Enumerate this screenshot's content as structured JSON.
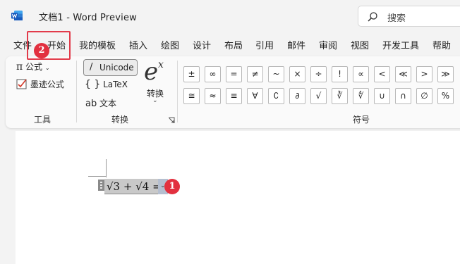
{
  "titlebar": {
    "title": "文档1  -  Word Preview",
    "search_placeholder": "搜索"
  },
  "menu": [
    "文件",
    "开始",
    "我的模板",
    "插入",
    "绘图",
    "设计",
    "布局",
    "引用",
    "邮件",
    "审阅",
    "视图",
    "开发工具",
    "帮助"
  ],
  "ribbon": {
    "tools": {
      "formula_label": "公式",
      "ink_formula_label": "墨迹公式",
      "group_label": "工具"
    },
    "convert": {
      "unicode_label": "Unicode",
      "latex_label": "LaTeX",
      "text_label": "文本",
      "convert_label": "转换",
      "group_label": "转换"
    },
    "symbols": {
      "group_label": "符号",
      "row1": [
        "±",
        "∞",
        "=",
        "≠",
        "~",
        "×",
        "÷",
        "!",
        "∝",
        "<",
        "≪",
        ">",
        "≫"
      ],
      "row2": [
        "≅",
        "≈",
        "≡",
        "∀",
        "∁",
        "∂",
        "√",
        "∛",
        "∜",
        "∪",
        "∩",
        "∅",
        "%"
      ]
    }
  },
  "document": {
    "equation": "√3 + √4 ="
  },
  "annotations": {
    "badge1": "1",
    "badge2": "2"
  },
  "colors": {
    "accent": "#e2303f",
    "word_blue": "#185abd"
  }
}
